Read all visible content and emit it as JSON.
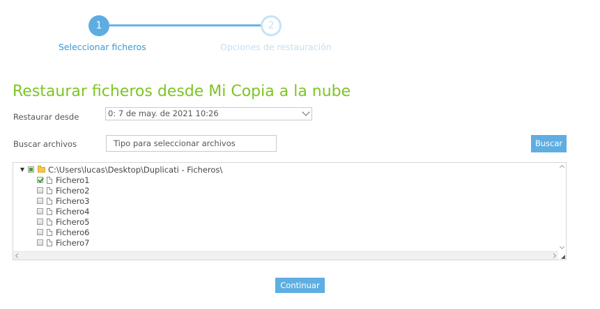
{
  "stepper": {
    "steps": [
      {
        "number": "1",
        "label": "Seleccionar ficheros",
        "state": "active"
      },
      {
        "number": "2",
        "label": "Opciones de restauración",
        "state": "inactive"
      }
    ]
  },
  "page_title": "Restaurar ficheros desde Mi Copia a la nube",
  "restore_from": {
    "label": "Restaurar desde",
    "selected": "0: 7 de may. de 2021 10:26"
  },
  "search": {
    "label": "Buscar archivos",
    "placeholder": "Tipo para seleccionar archivos",
    "button_label": "Buscar"
  },
  "tree": {
    "root": {
      "path": "C:\\Users\\lucas\\Desktop\\Duplicati - Ficheros\\",
      "state": "partial",
      "expanded": true
    },
    "items": [
      {
        "name": "Fichero1",
        "checked": true
      },
      {
        "name": "Fichero2",
        "checked": false
      },
      {
        "name": "Fichero3",
        "checked": false
      },
      {
        "name": "Fichero4",
        "checked": false
      },
      {
        "name": "Fichero5",
        "checked": false
      },
      {
        "name": "Fichero6",
        "checked": false
      },
      {
        "name": "Fichero7",
        "checked": false
      }
    ]
  },
  "continue_label": "Continuar",
  "colors": {
    "accent_blue": "#5eaee2",
    "title_green": "#7cc522",
    "check_green": "#2f9a2b"
  }
}
